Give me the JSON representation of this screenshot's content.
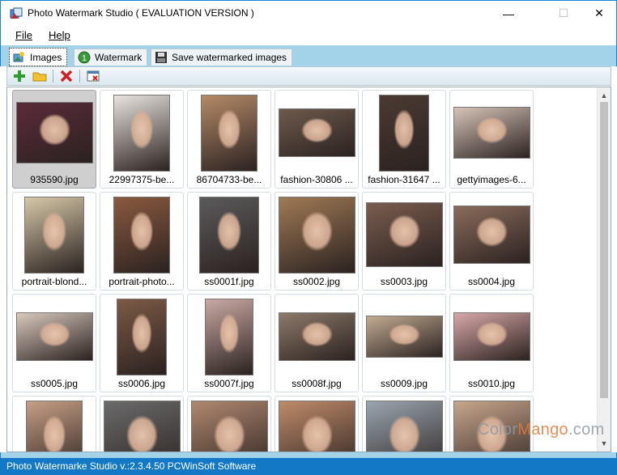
{
  "window": {
    "title": "Photo Watermark Studio ( EVALUATION VERSION )",
    "minimize_glyph": "—",
    "maximize_glyph": "☐",
    "close_glyph": "✕"
  },
  "menu": {
    "file": "File",
    "help": "Help"
  },
  "tabs": [
    {
      "label": "Images",
      "icon": "images-icon",
      "active": true
    },
    {
      "label": "Watermark",
      "icon": "watermark-icon",
      "active": false
    },
    {
      "label": "Save watermarked images",
      "icon": "save-icon",
      "active": false
    }
  ],
  "toolbar": {
    "add_icon": "add-icon",
    "open_folder_icon": "folder-icon",
    "remove_icon": "delete-icon",
    "clear_icon": "clear-list-icon"
  },
  "images": [
    {
      "label": "935590.jpg",
      "selected": true,
      "tone": "#5a2b3a"
    },
    {
      "label": "22997375-be...",
      "tone": "#e9e4df"
    },
    {
      "label": "86704733-be...",
      "tone": "#b58a68"
    },
    {
      "label": "fashion-30806 ...",
      "tone": "#6e5a4c"
    },
    {
      "label": "fashion-31647 ...",
      "tone": "#4b3a33"
    },
    {
      "label": "gettyimages-6...",
      "tone": "#d7c4b8"
    },
    {
      "label": "portrait-blond...",
      "tone": "#d6c8a8"
    },
    {
      "label": "portrait-photo...",
      "tone": "#8a5a3f"
    },
    {
      "label": "ss0001f.jpg",
      "tone": "#5b5b5b"
    },
    {
      "label": "ss0002.jpg",
      "tone": "#a07a55"
    },
    {
      "label": "ss0003.jpg",
      "tone": "#7a5d4f"
    },
    {
      "label": "ss0004.jpg",
      "tone": "#8b6c5c"
    },
    {
      "label": "ss0005.jpg",
      "tone": "#d9c9bd"
    },
    {
      "label": "ss0006.jpg",
      "tone": "#7c5a45"
    },
    {
      "label": "ss0007f.jpg",
      "tone": "#c9a9a3"
    },
    {
      "label": "ss0008f.jpg",
      "tone": "#8d7a6a"
    },
    {
      "label": "ss0009.jpg",
      "tone": "#c2ab92"
    },
    {
      "label": "ss0010.jpg",
      "tone": "#d8a8a8"
    },
    {
      "label": "",
      "tone": "#c79f86"
    },
    {
      "label": "",
      "tone": "#6b6b6b"
    },
    {
      "label": "",
      "tone": "#b08870"
    },
    {
      "label": "",
      "tone": "#bf8b6a"
    },
    {
      "label": "",
      "tone": "#9aa5b0"
    },
    {
      "label": "",
      "tone": "#c8a68c"
    }
  ],
  "status": {
    "text": "Photo Watermarke Studio v.:2.3.4.50 PCWinSoft Software"
  },
  "overlay": {
    "watermark_part1": "Color",
    "watermark_part2": "Mango",
    "watermark_part3": ".com"
  }
}
